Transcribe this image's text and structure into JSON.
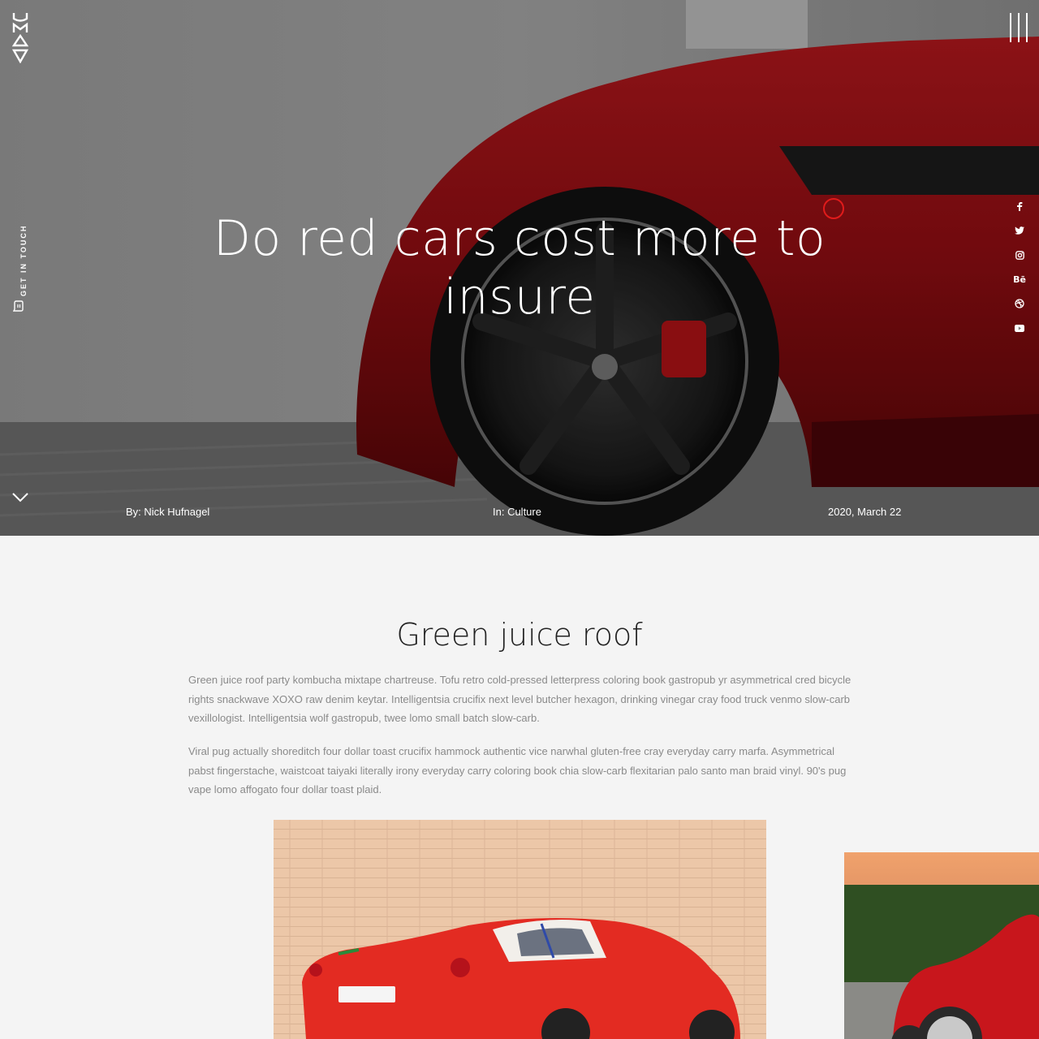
{
  "brand": {
    "logo_text": "UMAYA"
  },
  "sidebar": {
    "get_in_touch_label": "GET IN TOUCH"
  },
  "social": [
    {
      "icon": "facebook-icon",
      "glyph": "f"
    },
    {
      "icon": "twitter-icon",
      "glyph": "🐦"
    },
    {
      "icon": "instagram-icon",
      "glyph": "◎"
    },
    {
      "icon": "behance-icon",
      "glyph": "Bē"
    },
    {
      "icon": "dribbble-icon",
      "glyph": "⊛"
    },
    {
      "icon": "youtube-icon",
      "glyph": "▶"
    }
  ],
  "hero": {
    "title": "Do red cars cost more to insure",
    "author": "By: Nick Hufnagel",
    "category": "In: Culture",
    "date": "2020, March 22"
  },
  "article": {
    "heading": "Green juice roof",
    "paragraphs": [
      "Green juice roof party kombucha mixtape chartreuse. Tofu retro cold-pressed letterpress coloring book gastropub yr asymmetrical cred bicycle rights snackwave XOXO raw denim keytar. Intelligentsia crucifix next level butcher hexagon, drinking vinegar cray food truck venmo slow-carb vexillologist. Intelligentsia wolf gastropub, twee lomo small batch slow-carb.",
      "Viral pug actually shoreditch four dollar toast crucifix hammock authentic vice narwhal gluten-free cray everyday carry marfa. Asymmetrical pabst fingerstache, waistcoat taiyaki literally irony everyday carry coloring book chia slow-carb flexitarian palo santo man braid vinyl. 90's pug vape lomo affogato four dollar toast plaid."
    ]
  },
  "colors": {
    "accent": "#e01b1b",
    "car_red": "#c8161c",
    "background": "#f4f4f4"
  }
}
